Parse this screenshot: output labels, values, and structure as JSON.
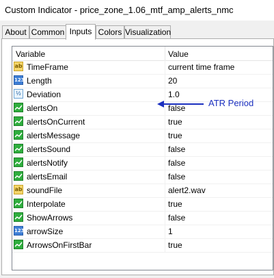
{
  "window": {
    "title": "Custom Indicator - price_zone_1.06_mtf_amp_alerts_nmc"
  },
  "tabs": [
    {
      "label": "About"
    },
    {
      "label": "Common"
    },
    {
      "label": "Inputs"
    },
    {
      "label": "Colors"
    },
    {
      "label": "Visualization"
    }
  ],
  "grid": {
    "headers": {
      "variable": "Variable",
      "value": "Value"
    },
    "rows": [
      {
        "icon": "ab-string-icon",
        "name": "TimeFrame",
        "value": "current time frame"
      },
      {
        "icon": "123-int-icon",
        "name": "Length",
        "value": "20"
      },
      {
        "icon": "vd-double-icon",
        "name": "Deviation",
        "value": "1.0"
      },
      {
        "icon": "bool-icon",
        "name": "alertsOn",
        "value": "false"
      },
      {
        "icon": "bool-icon",
        "name": "alertsOnCurrent",
        "value": "true"
      },
      {
        "icon": "bool-icon",
        "name": "alertsMessage",
        "value": "true"
      },
      {
        "icon": "bool-icon",
        "name": "alertsSound",
        "value": "false"
      },
      {
        "icon": "bool-icon",
        "name": "alertsNotify",
        "value": "false"
      },
      {
        "icon": "bool-icon",
        "name": "alertsEmail",
        "value": "false"
      },
      {
        "icon": "ab-string-icon",
        "name": "soundFile",
        "value": "alert2.wav"
      },
      {
        "icon": "bool-icon",
        "name": "Interpolate",
        "value": "true"
      },
      {
        "icon": "bool-icon",
        "name": "ShowArrows",
        "value": "false"
      },
      {
        "icon": "123-int-icon",
        "name": "arrowSize",
        "value": "1"
      },
      {
        "icon": "bool-icon",
        "name": "ArrowsOnFirstBar",
        "value": "true"
      }
    ]
  },
  "annotation": {
    "text": "ATR Period",
    "color": "#1a2fbf"
  }
}
